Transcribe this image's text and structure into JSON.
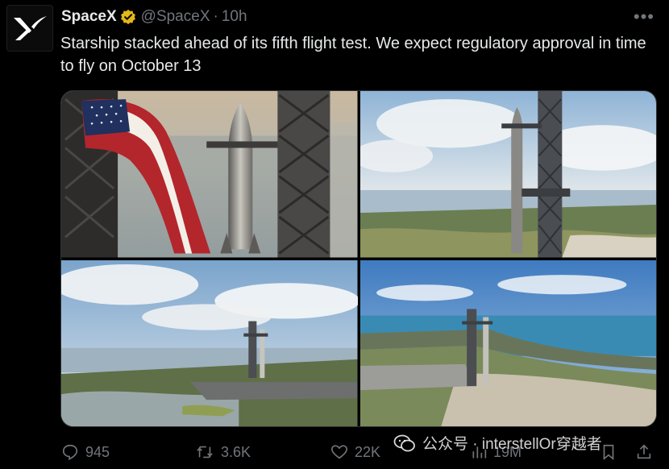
{
  "tweet": {
    "author": {
      "name": "SpaceX",
      "handle": "@SpaceX",
      "separator": "·",
      "time": "10h",
      "verified": true
    },
    "text": "Starship stacked ahead of its fifth flight test. We expect regulatory approval in time to fly on October 13",
    "media": [
      {
        "name": "starship-with-american-flag"
      },
      {
        "name": "starship-on-tower-coast"
      },
      {
        "name": "starbase-launch-site-aerial"
      },
      {
        "name": "starbase-launch-site-aerial-ocean"
      }
    ],
    "actions": {
      "replies": "945",
      "retweets": "3.6K",
      "likes": "22K",
      "views": "19M"
    }
  },
  "watermark": {
    "text": "公众号 · interstellOr穿越者"
  },
  "colors": {
    "background": "#000000",
    "text": "#e7e9ea",
    "muted": "#71767b",
    "verified": "#e2b719"
  }
}
